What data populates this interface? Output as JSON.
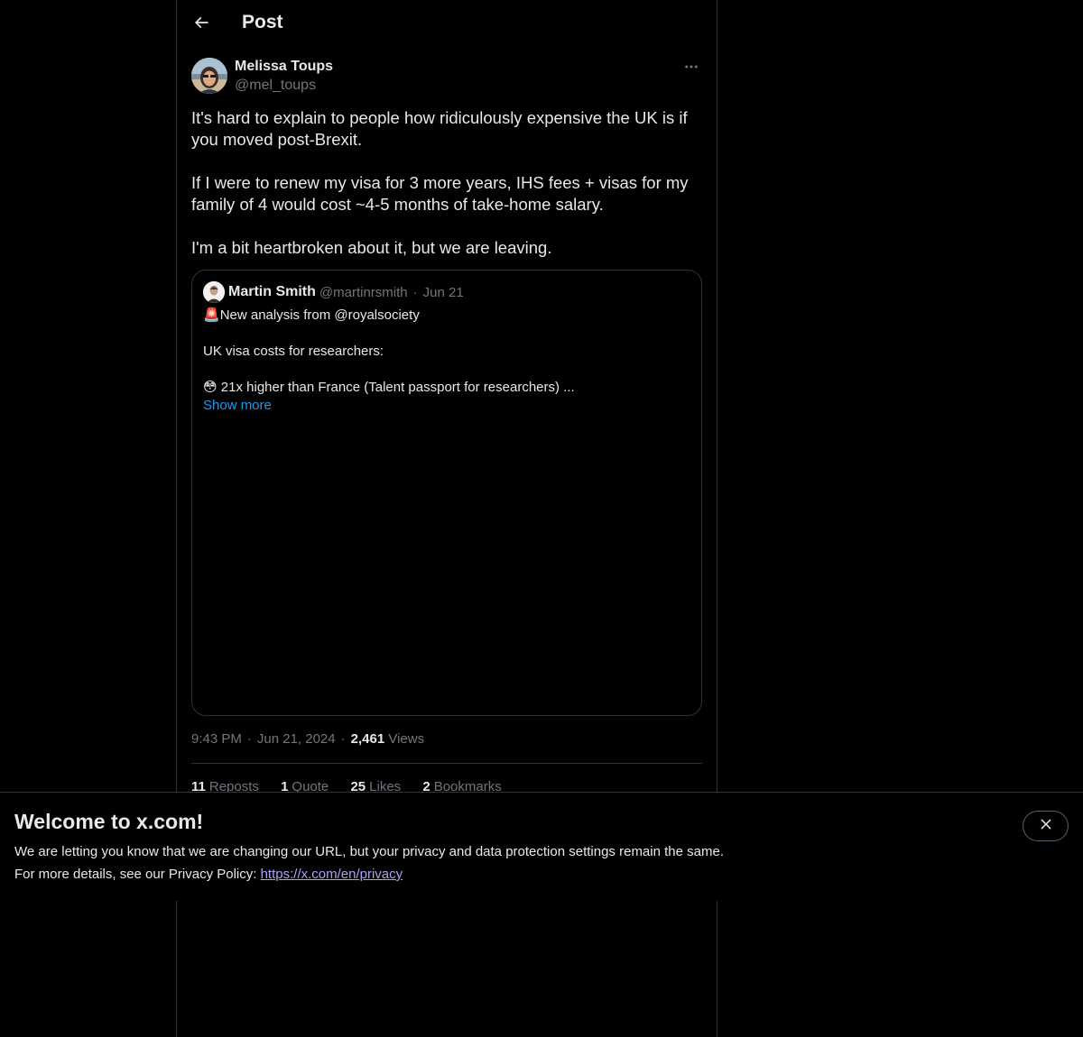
{
  "header": {
    "title": "Post",
    "back_icon": "arrow-left-icon"
  },
  "post": {
    "author": {
      "name": "Melissa Toups",
      "handle": "@mel_toups"
    },
    "more_icon": "ellipsis-icon",
    "paragraphs": [
      "It's hard to explain to people how ridiculously expensive the UK is if you moved post-Brexit.",
      "If I were to renew my visa for 3 more years, IHS fees + visas for my family of 4 would cost ~4-5 months of take-home salary.",
      "I'm a bit heartbroken about it, but we are leaving."
    ],
    "quote": {
      "author_name": "Martin Smith",
      "author_handle": "@martinrsmith",
      "separator": "·",
      "date": "Jun 21",
      "line1_emoji": "🚨",
      "line1": "New analysis from @royalsociety",
      "line2": "UK visa costs for researchers:",
      "line3_emoji": "😳",
      "line3": " 21x higher than France (Talent passport for researchers) ...",
      "show_more": "Show more"
    },
    "meta": {
      "time": "9:43 PM",
      "separator": "·",
      "date": "Jun 21, 2024",
      "views_count": "2,461",
      "views_label": "Views"
    },
    "stats": {
      "reposts_count": "11",
      "reposts_label": "Reposts",
      "quotes_count": "1",
      "quotes_label": "Quote",
      "likes_count": "25",
      "likes_label": "Likes",
      "bookmarks_count": "2",
      "bookmarks_label": "Bookmarks"
    }
  },
  "banner": {
    "title": "Welcome to x.com!",
    "line1": "We are letting you know that we are changing our URL, but your privacy and data protection settings remain the same.",
    "line2_prefix": "For more details, see our Privacy Policy: ",
    "link_text": "https://x.com/en/privacy",
    "close_icon": "close-icon"
  },
  "colors": {
    "background": "#000000",
    "text_primary": "#e7e9ea",
    "text_secondary": "#71767b",
    "accent": "#1d9bf0",
    "link": "#a7a4f5",
    "border": "#2f3336"
  }
}
